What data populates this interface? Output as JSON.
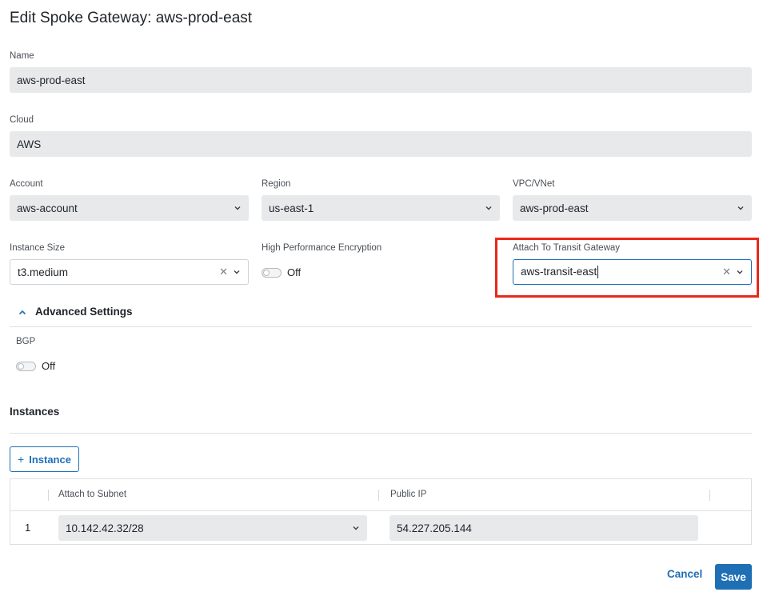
{
  "page": {
    "title": "Edit Spoke Gateway: aws-prod-east"
  },
  "form": {
    "name": {
      "label": "Name",
      "value": "aws-prod-east"
    },
    "cloud": {
      "label": "Cloud",
      "value": "AWS"
    },
    "account": {
      "label": "Account",
      "value": "aws-account"
    },
    "region": {
      "label": "Region",
      "value": "us-east-1"
    },
    "vpc": {
      "label": "VPC/VNet",
      "value": "aws-prod-east"
    },
    "instance_size": {
      "label": "Instance Size",
      "value": "t3.medium"
    },
    "hpe": {
      "label": "High Performance Encryption",
      "state": "Off"
    },
    "transit": {
      "label": "Attach To Transit Gateway",
      "value": "aws-transit-east"
    }
  },
  "advanced": {
    "title": "Advanced Settings",
    "bgp": {
      "label": "BGP",
      "state": "Off"
    }
  },
  "instances": {
    "title": "Instances",
    "add_label": "Instance",
    "columns": [
      "Attach to Subnet",
      "Public IP"
    ],
    "rows": [
      {
        "num": "1",
        "subnet": "10.142.42.32/28",
        "public_ip": "54.227.205.144"
      }
    ]
  },
  "footer": {
    "cancel_label": "Cancel",
    "save_label": "Save"
  },
  "colors": {
    "accent": "#1f6fb5",
    "highlight": "#e8291b",
    "field_bg": "#e8e9eb"
  },
  "icons": {
    "select": "chevron-down-icon",
    "clear": "clear-icon",
    "collapse": "chevron-up-icon",
    "add": "plus-icon"
  }
}
